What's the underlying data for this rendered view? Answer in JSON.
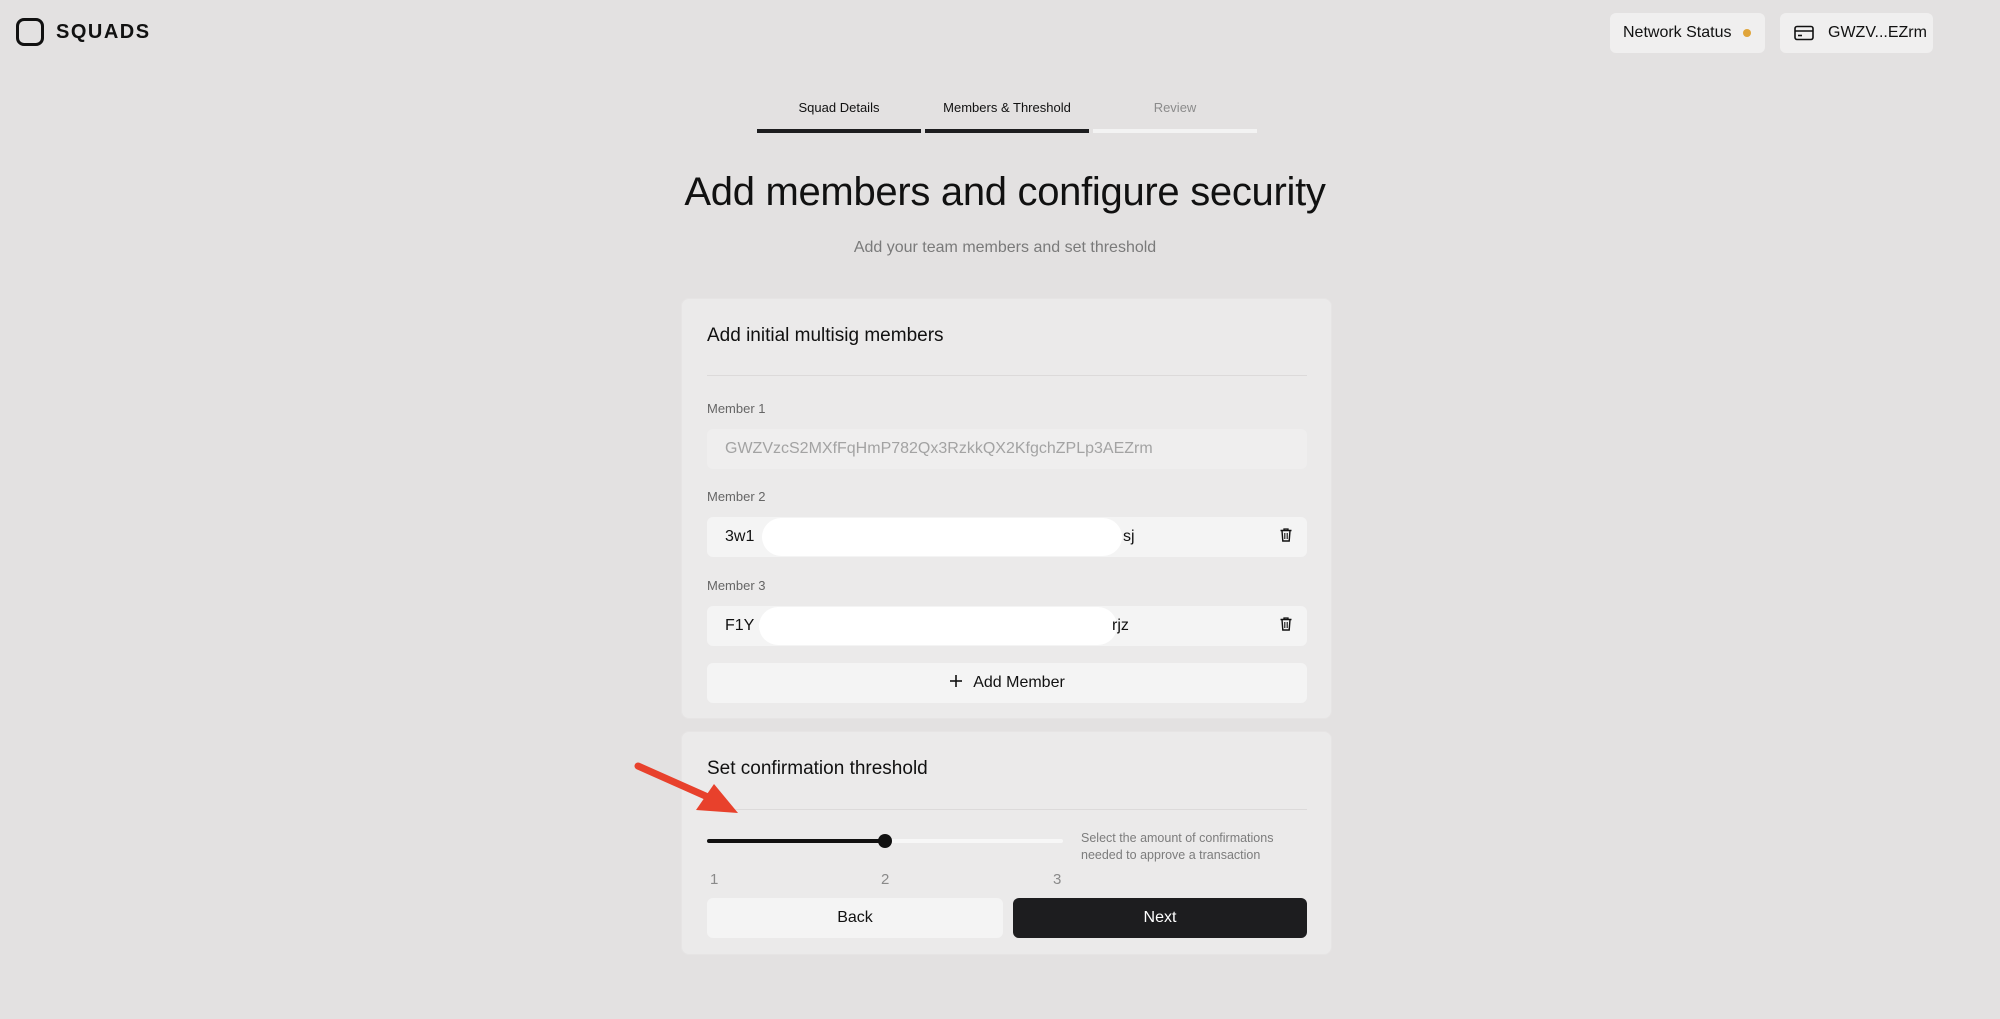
{
  "brand": {
    "name": "SQUADS"
  },
  "header": {
    "network_status_label": "Network Status",
    "network_status_color": "#e0a43a",
    "wallet_label": "GWZV...EZrm"
  },
  "stepper": {
    "steps": [
      {
        "label": "Squad Details",
        "state": "complete"
      },
      {
        "label": "Members & Threshold",
        "state": "active"
      },
      {
        "label": "Review",
        "state": "upcoming"
      }
    ]
  },
  "page": {
    "title": "Add members and configure security",
    "subtitle": "Add your team members and set threshold"
  },
  "members_card": {
    "title": "Add initial multisig members",
    "members": [
      {
        "label": "Member 1",
        "value": "GWZVzcS2MXfFqHmP782Qx3RzkkQX2KfgchZPLp3AEZrm",
        "editable": false
      },
      {
        "label": "Member 2",
        "value_start": "3w1",
        "value_end": "sj",
        "editable": true
      },
      {
        "label": "Member 3",
        "value_start": "F1Y",
        "value_end": "rjz",
        "editable": true
      }
    ],
    "add_member_label": "Add Member"
  },
  "threshold_card": {
    "title": "Set confirmation threshold",
    "slider": {
      "min": 1,
      "max": 3,
      "value": 2,
      "ticks": [
        "1",
        "2",
        "3"
      ]
    },
    "help_text": "Select the amount of confirmations needed to approve a transaction",
    "back_label": "Back",
    "next_label": "Next"
  },
  "colors": {
    "background": "#e3e1e1",
    "primary_button": "#1d1d1f",
    "annotation_arrow": "#e8412c"
  }
}
